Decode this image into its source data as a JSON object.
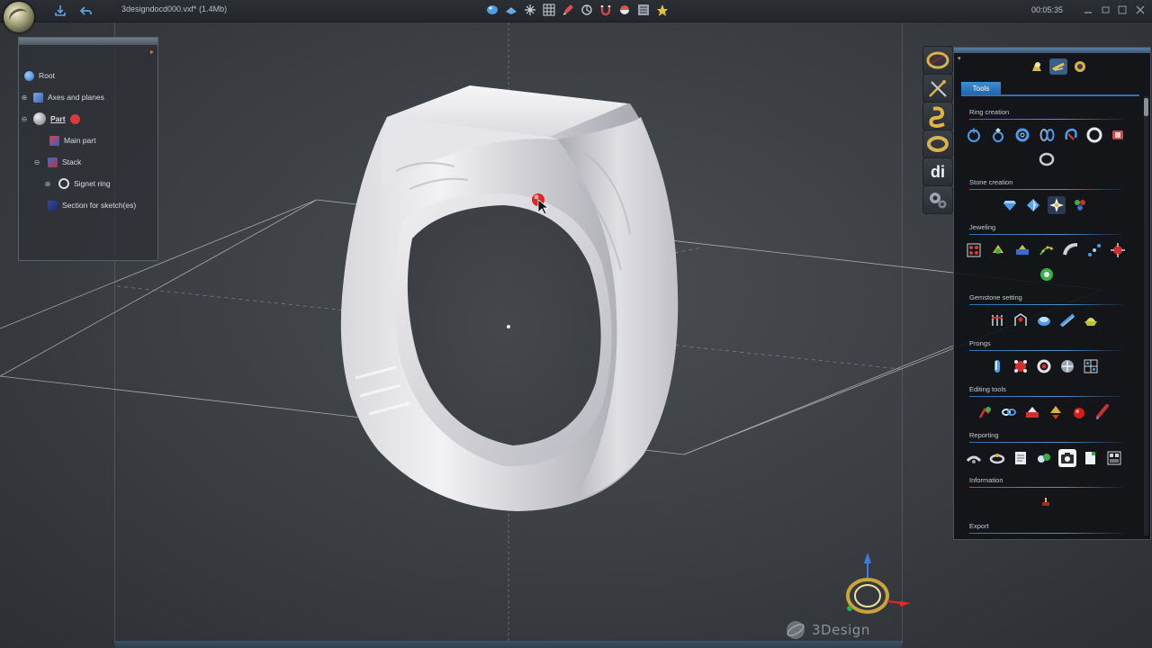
{
  "titlebar": {
    "filename": "3designdocd000.vxf* (1.4Mb)",
    "clock": "00:05:35"
  },
  "tree": {
    "items": [
      {
        "label": "Root",
        "icon": "globe-icon"
      },
      {
        "label": "Axes and planes",
        "icon": "planes-icon"
      },
      {
        "label": "Part",
        "icon": "part-icon"
      },
      {
        "label": "Main part",
        "icon": "main-part-icon"
      },
      {
        "label": "Stack",
        "icon": "stack-icon"
      },
      {
        "label": "Signet ring",
        "icon": "ring-icon"
      },
      {
        "label": "Section for sketch(es)",
        "icon": "section-icon"
      }
    ]
  },
  "tools": {
    "tab_label": "Tools",
    "sections": [
      {
        "label": "Ring creation"
      },
      {
        "label": "Stone creation"
      },
      {
        "label": "Jeweling"
      },
      {
        "label": "Gemstone setting"
      },
      {
        "label": "Prongs"
      },
      {
        "label": "Editing tools"
      },
      {
        "label": "Reporting"
      },
      {
        "label": "Information"
      },
      {
        "label": "Export"
      }
    ]
  },
  "side": {
    "di_label": "di"
  },
  "watermark": {
    "text": "3Design"
  },
  "colors": {
    "accent": "#2f6fb2",
    "gold": "#c9a43a",
    "red_marker": "#d42a2a"
  }
}
